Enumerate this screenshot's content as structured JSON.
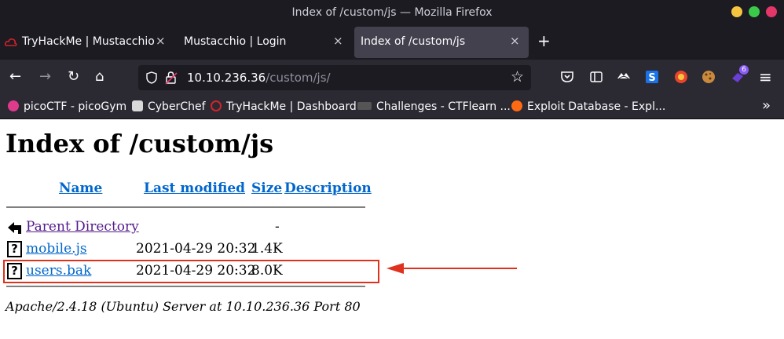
{
  "window": {
    "title": "Index of /custom/js — Mozilla Firefox",
    "controls_colors": [
      "#f5c542",
      "#3cc94a",
      "#e5366a"
    ]
  },
  "tabs": [
    {
      "label": "TryHackMe | Mustacchio",
      "close": "×",
      "active": false,
      "icon": "tryhackme-icon"
    },
    {
      "label": "Mustacchio | Login",
      "close": "×",
      "active": false,
      "icon": ""
    },
    {
      "label": "Index of /custom/js",
      "close": "×",
      "active": true,
      "icon": ""
    }
  ],
  "new_tab_label": "+",
  "navbar": {
    "back": "←",
    "forward": "→",
    "reload": "↻",
    "home": "⌂",
    "url_host": "10.10.236.36",
    "url_path": "/custom/js/",
    "bookmark_star": "☆",
    "menu": "≡",
    "extension_badge": "6"
  },
  "bookmarks": [
    {
      "label": "picoCTF - picoGym",
      "icon": "picoctf-icon",
      "color": "#e03a8c"
    },
    {
      "label": "CyberChef",
      "icon": "cyberchef-icon",
      "color": "#d9d9d9"
    },
    {
      "label": "TryHackMe | Dashboard",
      "icon": "tryhackme-icon",
      "color": "#d2232a"
    },
    {
      "label": "Challenges - CTFlearn ...",
      "icon": "ctflearn-icon",
      "color": "#888888"
    },
    {
      "label": "Exploit Database - Expl...",
      "icon": "exploit-db-icon",
      "color": "#ff6a13"
    }
  ],
  "bookmarks_overflow": "»",
  "page": {
    "heading": "Index of /custom/js",
    "columns": {
      "name": "Name",
      "last_modified": "Last modified",
      "size": "Size",
      "description": "Description"
    },
    "rows": [
      {
        "name": "Parent Directory",
        "modified": "",
        "size": "-",
        "icon": "back-arrow-icon"
      },
      {
        "name": "mobile.js",
        "modified": "2021-04-29 20:32",
        "size": "1.4K",
        "icon": "unknown-file-icon"
      },
      {
        "name": "users.bak",
        "modified": "2021-04-29 20:32",
        "size": "8.0K",
        "icon": "unknown-file-icon"
      }
    ],
    "server_signature": "Apache/2.4.18 (Ubuntu) Server at 10.10.236.36 Port 80"
  },
  "annotation": {
    "color": "#e0301e"
  }
}
